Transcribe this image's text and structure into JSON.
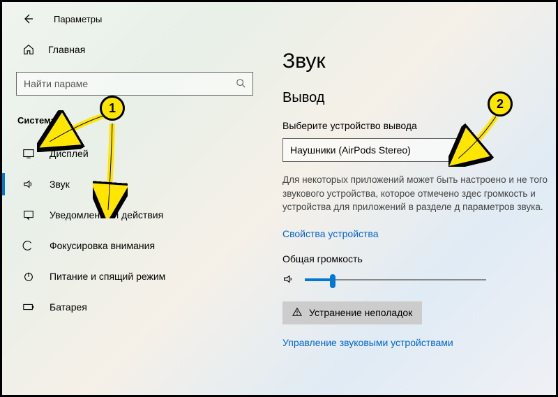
{
  "header": {
    "title": "Параметры"
  },
  "sidebar": {
    "home_label": "Главная",
    "search_placeholder": "Найти параме",
    "section_label": "Система",
    "items": [
      {
        "label": "Дисплей",
        "icon": "display-icon",
        "active": false
      },
      {
        "label": "Звук",
        "icon": "sound-icon",
        "active": true
      },
      {
        "label": "Уведомления и действия",
        "icon": "notifications-icon",
        "active": false
      },
      {
        "label": "Фокусировка внимания",
        "icon": "focus-icon",
        "active": false
      },
      {
        "label": "Питание и спящий режим",
        "icon": "power-icon",
        "active": false
      },
      {
        "label": "Батарея",
        "icon": "battery-icon",
        "active": false
      }
    ]
  },
  "content": {
    "page_title": "Звук",
    "output_section": "Вывод",
    "output_label": "Выберите устройство вывода",
    "output_device": "Наушники (AirPods Stereo)",
    "help_text": "Для некоторых приложений может быть настроено и не того звукового устройства, которое отмечено здес громкость и устройства для приложений в разделе д параметров звука.",
    "device_properties_link": "Свойства устройства",
    "volume_label": "Общая громкость",
    "troubleshoot_label": "Устранение неполадок",
    "manage_devices_link": "Управление звуковыми устройствами"
  },
  "annotations": {
    "marker1": "1",
    "marker2": "2"
  }
}
